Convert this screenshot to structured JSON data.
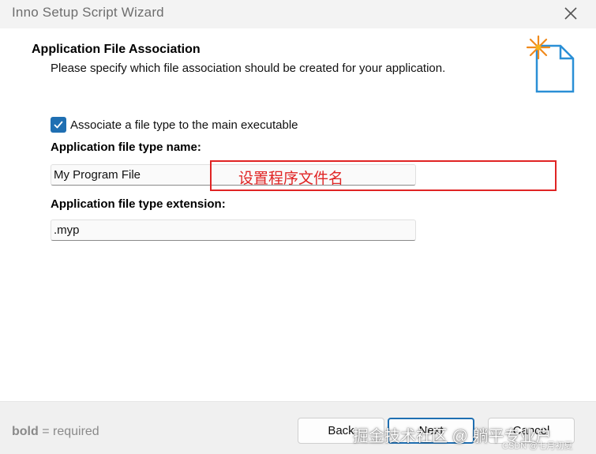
{
  "window": {
    "title": "Inno Setup Script Wizard",
    "close_icon": "close-icon"
  },
  "header": {
    "title": "Application File Association",
    "subtitle": "Please specify which file association should be created for your application.",
    "icon": "wizard-document-sparkle-icon"
  },
  "form": {
    "associate_checkbox": {
      "label": "Associate a file type to the main executable",
      "checked": true
    },
    "type_name": {
      "label": "Application file type name:",
      "value": "My Program File"
    },
    "type_extension": {
      "label": "Application file type extension:",
      "value": ".myp"
    }
  },
  "annotation": {
    "text": "设置程序文件名",
    "color": "#e02424"
  },
  "footer": {
    "hint_bold": "bold",
    "hint_rest": " = required",
    "back_label": "Back",
    "next_label": "Next",
    "cancel_label": "Cancel"
  },
  "watermark": {
    "main": "掘金技术社区 @ 躺平专业户",
    "small": "CSDN @七月初夏"
  },
  "colors": {
    "accent": "#1f6fb2",
    "annotation": "#e02424"
  }
}
